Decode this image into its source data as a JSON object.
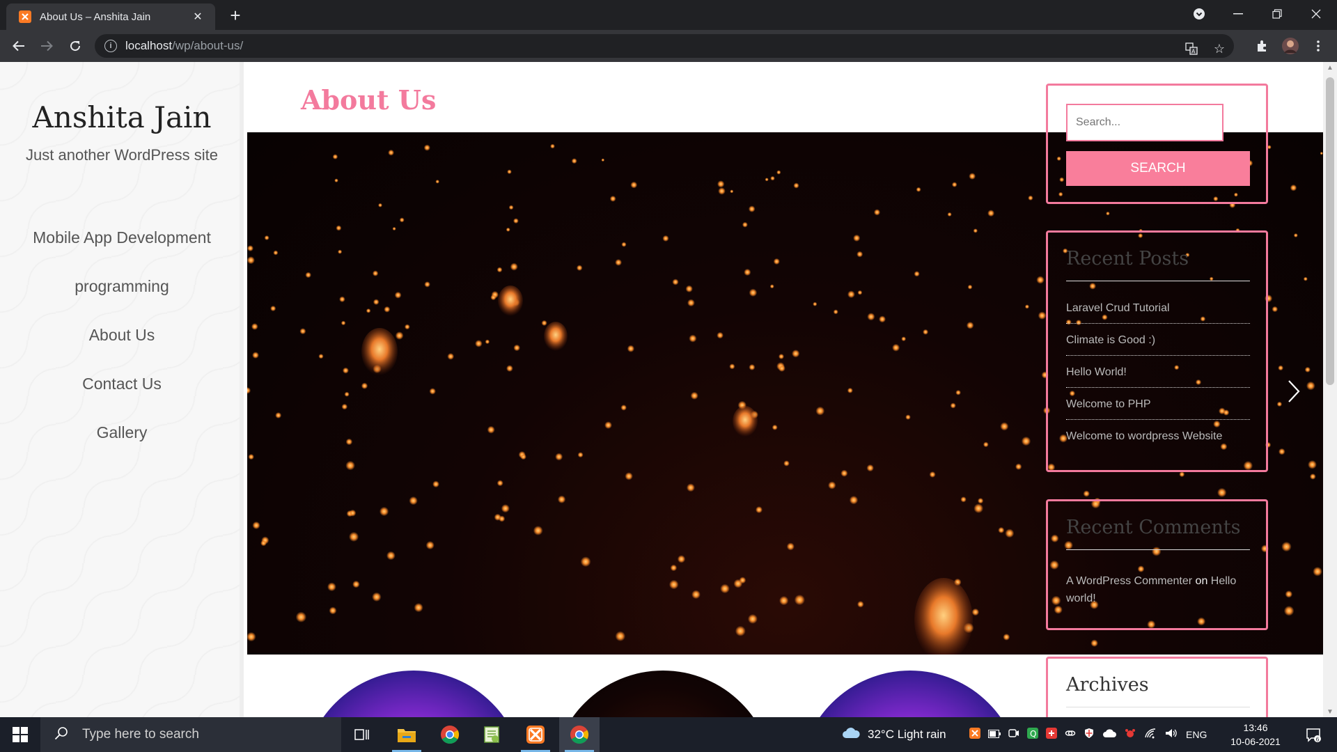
{
  "browser": {
    "tab_title": "About Us – Anshita Jain",
    "url_host": "localhost",
    "url_path": "/wp/about-us/"
  },
  "site": {
    "title": "Anshita Jain",
    "tagline": "Just another WordPress site",
    "menu": [
      {
        "label": "Mobile App Development"
      },
      {
        "label": "programming"
      },
      {
        "label": "About Us"
      },
      {
        "label": "Contact Us"
      },
      {
        "label": "Gallery"
      }
    ]
  },
  "main": {
    "title": "About Us"
  },
  "widgets": {
    "search": {
      "placeholder": "Search...",
      "button": "SEARCH"
    },
    "recent_posts": {
      "title": "Recent Posts",
      "items": [
        {
          "label": "Laravel Crud Tutorial"
        },
        {
          "label": "Climate is Good :)"
        },
        {
          "label": "Hello World!"
        },
        {
          "label": "Welcome to PHP"
        },
        {
          "label": "Welcome to wordpress Website"
        }
      ]
    },
    "recent_comments": {
      "title": "Recent Comments",
      "author": "A WordPress Commenter",
      "on": "on",
      "post": "Hello world!"
    },
    "archives": {
      "title": "Archives"
    }
  },
  "taskbar": {
    "search_placeholder": "Type here to search",
    "weather": "32°C  Light rain",
    "language": "ENG",
    "time": "13:46",
    "date": "10-06-2021",
    "notification_count": "6"
  },
  "colors": {
    "accent_pink": "#f37a9d",
    "search_button": "#f97e9b",
    "browser_dark": "#202124"
  }
}
